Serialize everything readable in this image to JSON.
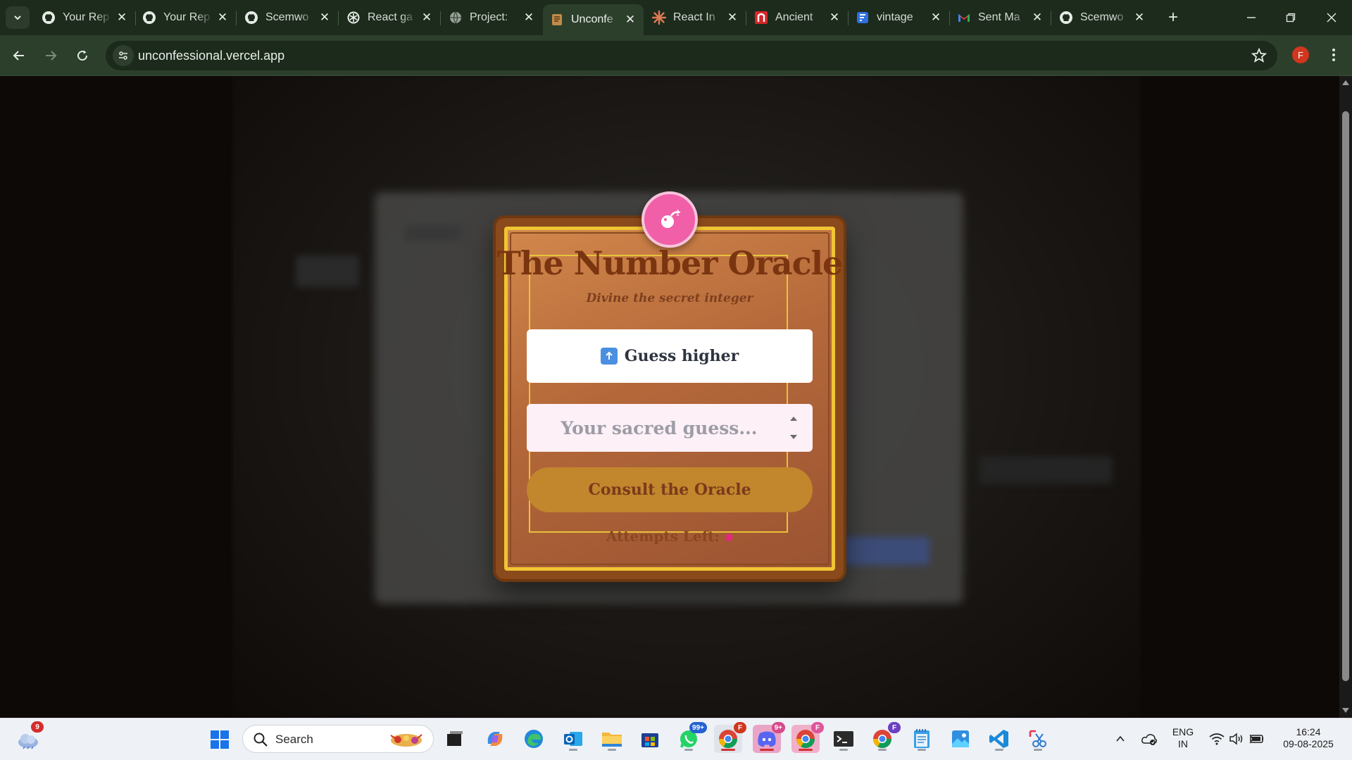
{
  "browser": {
    "tabs": [
      {
        "title": "Your Rep",
        "icon": "github-icon"
      },
      {
        "title": "Your Rep",
        "icon": "github-icon"
      },
      {
        "title": "Scemwo",
        "icon": "github-icon"
      },
      {
        "title": "React ga",
        "icon": "openai-icon"
      },
      {
        "title": "Project: ",
        "icon": "globe-icon"
      },
      {
        "title": "Unconfe",
        "icon": "scroll-icon",
        "active": true
      },
      {
        "title": "React In",
        "icon": "claude-icon"
      },
      {
        "title": "Ancient",
        "icon": "temple-icon"
      },
      {
        "title": "vintage ",
        "icon": "document-icon"
      },
      {
        "title": "Sent Ma",
        "icon": "gmail-icon"
      },
      {
        "title": "Scemwo",
        "icon": "github-icon"
      }
    ],
    "url": "unconfessional.vercel.app",
    "profile_initial": "F"
  },
  "oracle": {
    "title": "The Number Oracle",
    "subtitle": "Divine the secret integer",
    "hint": "Guess higher",
    "input_placeholder": "Your sacred guess...",
    "consult_label": "Consult the Oracle",
    "attempts_label": "Attempts Left:",
    "attempts_value": "",
    "colors": {
      "badge": "#f05fa7",
      "gold": "#f0c434",
      "title": "#7a3510",
      "button": "#c2862d"
    }
  },
  "taskbar": {
    "weather_badge": "9",
    "search_label": "Search",
    "whatsapp_badge": "99+",
    "discord_badge": "9+",
    "chrome_profile_badge": "F",
    "language_line1": "ENG",
    "language_line2": "IN",
    "time": "16:24",
    "date": "09-08-2025"
  }
}
